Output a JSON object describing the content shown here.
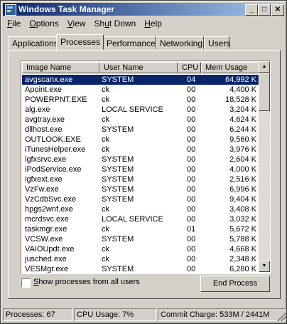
{
  "window": {
    "title": "Windows Task Manager"
  },
  "menu": [
    {
      "pre": "",
      "u": "F",
      "post": "ile"
    },
    {
      "pre": "",
      "u": "O",
      "post": "ptions"
    },
    {
      "pre": "",
      "u": "V",
      "post": "iew"
    },
    {
      "pre": "Sh",
      "u": "u",
      "post": "t Down"
    },
    {
      "pre": "",
      "u": "H",
      "post": "elp"
    }
  ],
  "tabs": [
    "Applications",
    "Processes",
    "Performance",
    "Networking",
    "Users"
  ],
  "active_tab": "Processes",
  "columns": [
    "Image Name",
    "User Name",
    "CPU",
    "Mem Usage"
  ],
  "processes": [
    {
      "image": "avgscanx.exe",
      "user": "SYSTEM",
      "cpu": "04",
      "mem": "64,992 K",
      "selected": true
    },
    {
      "image": "Apoint.exe",
      "user": "ck",
      "cpu": "00",
      "mem": "4,400 K"
    },
    {
      "image": "POWERPNT.EXE",
      "user": "ck",
      "cpu": "00",
      "mem": "18,528 K"
    },
    {
      "image": "alg.exe",
      "user": "LOCAL SERVICE",
      "cpu": "00",
      "mem": "3,204 K"
    },
    {
      "image": "avgtray.exe",
      "user": "ck",
      "cpu": "00",
      "mem": "4,624 K"
    },
    {
      "image": "dllhost.exe",
      "user": "SYSTEM",
      "cpu": "00",
      "mem": "6,244 K"
    },
    {
      "image": "OUTLOOK.EXE",
      "user": "ck",
      "cpu": "00",
      "mem": "9,560 K"
    },
    {
      "image": "iTunesHelper.exe",
      "user": "ck",
      "cpu": "00",
      "mem": "3,976 K"
    },
    {
      "image": "igfxsrvc.exe",
      "user": "SYSTEM",
      "cpu": "00",
      "mem": "2,604 K"
    },
    {
      "image": "iPodService.exe",
      "user": "SYSTEM",
      "cpu": "00",
      "mem": "4,000 K"
    },
    {
      "image": "igfxext.exe",
      "user": "SYSTEM",
      "cpu": "00",
      "mem": "2,516 K"
    },
    {
      "image": "VzFw.exe",
      "user": "SYSTEM",
      "cpu": "00",
      "mem": "6,996 K"
    },
    {
      "image": "VzCdbSvc.exe",
      "user": "SYSTEM",
      "cpu": "00",
      "mem": "9,404 K"
    },
    {
      "image": "hpgs2wnf.exe",
      "user": "ck",
      "cpu": "00",
      "mem": "3,408 K"
    },
    {
      "image": "mcrdsvc.exe",
      "user": "LOCAL SERVICE",
      "cpu": "00",
      "mem": "3,032 K"
    },
    {
      "image": "taskmgr.exe",
      "user": "ck",
      "cpu": "01",
      "mem": "5,672 K"
    },
    {
      "image": "VCSW.exe",
      "user": "SYSTEM",
      "cpu": "00",
      "mem": "5,788 K"
    },
    {
      "image": "VAIOUpdt.exe",
      "user": "ck",
      "cpu": "00",
      "mem": "4,668 K"
    },
    {
      "image": "jusched.exe",
      "user": "ck",
      "cpu": "00",
      "mem": "2,348 K"
    },
    {
      "image": "VESMgr.exe",
      "user": "SYSTEM",
      "cpu": "00",
      "mem": "6,280 K"
    }
  ],
  "show_all": {
    "pre": "",
    "u": "S",
    "post": "how processes from all users",
    "checked": false
  },
  "end_process_label": "End Process",
  "status": {
    "processes": "Processes: 67",
    "cpu": "CPU Usage: 7%",
    "commit": "Commit Charge: 533M / 2441M"
  }
}
